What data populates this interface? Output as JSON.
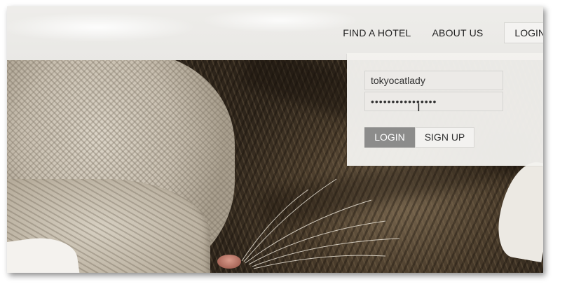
{
  "nav": {
    "items": [
      {
        "label": "FIND A HOTEL"
      },
      {
        "label": "ABOUT US"
      }
    ],
    "login_label": "LOGIN"
  },
  "login_panel": {
    "username_value": "tokyocatlady",
    "password_value": "••••••••••••••••",
    "login_button": "LOGIN",
    "signup_button": "SIGN UP"
  },
  "icons": {
    "cursor": "text-cursor-icon"
  },
  "colors": {
    "login_button_bg": "#8c8c8b",
    "panel_bg": "#f2f1ee"
  }
}
